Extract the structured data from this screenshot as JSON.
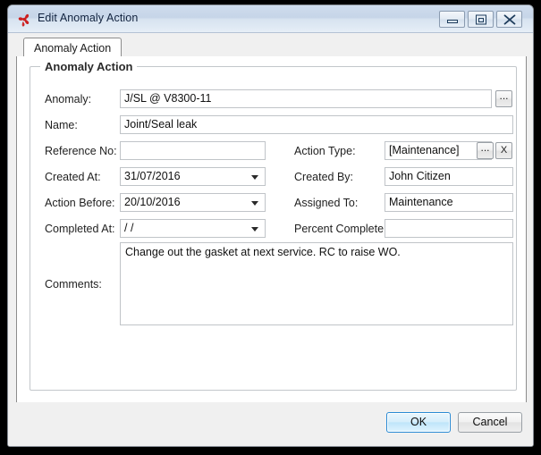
{
  "window": {
    "title": "Edit Anomaly Action",
    "icon": "app-logo-icon",
    "controls": {
      "minimize": "minimize-icon",
      "maximize": "maximize-icon",
      "close": "close-icon"
    }
  },
  "tabs": [
    {
      "label": "Anomaly Action",
      "selected": true
    }
  ],
  "group": {
    "title": "Anomaly Action"
  },
  "fields": {
    "anomaly": {
      "label": "Anomaly:",
      "value": "J/SL @ V8300-11",
      "placeholder": "",
      "browse_button": "..."
    },
    "name": {
      "label": "Name:",
      "value": "Joint/Seal leak",
      "placeholder": ""
    },
    "reference_no": {
      "label": "Reference No:",
      "value": "",
      "placeholder": ""
    },
    "action_type": {
      "label": "Action Type:",
      "value": "[Maintenance]",
      "browse_button": "...",
      "clear_button": "X"
    },
    "created_at": {
      "label": "Created At:",
      "value": "31/07/2016",
      "dropdown_icon": "chevron-down-icon"
    },
    "created_by": {
      "label": "Created By:",
      "value": "John Citizen",
      "placeholder": ""
    },
    "action_before": {
      "label": "Action Before:",
      "value": "20/10/2016",
      "dropdown_icon": "chevron-down-icon"
    },
    "assigned_to": {
      "label": "Assigned To:",
      "value": "Maintenance",
      "placeholder": ""
    },
    "completed_at": {
      "label": "Completed At:",
      "value": "  /  /",
      "dropdown_icon": "chevron-down-icon"
    },
    "percent_complete": {
      "label": "Percent Complete:",
      "value": "",
      "placeholder": ""
    },
    "comments": {
      "label": "Comments:",
      "value": "Change out the gasket at next service. RC to raise WO.",
      "placeholder": ""
    }
  },
  "footer": {
    "ok_label": "OK",
    "cancel_label": "Cancel"
  },
  "colors": {
    "title_bar": "#c6d5e8",
    "accent": "#2a8bd4",
    "logo_red": "#cc1f1f",
    "border": "#8c8c8c",
    "group_border": "#c3c7cb",
    "field_border": "#c0c4c8",
    "dialog_bg": "#f0f0f0"
  }
}
